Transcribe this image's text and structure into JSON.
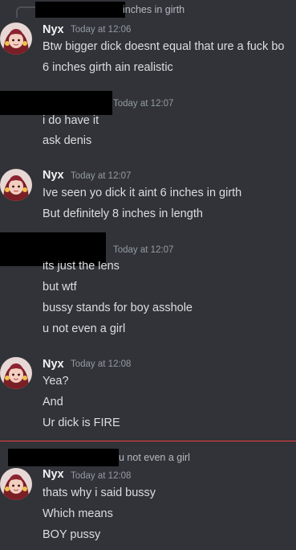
{
  "colors": {
    "background": "#313338",
    "text": "#dbdee1",
    "username": "#f2f3f5",
    "timestamp": "#949ba4",
    "new_messages_divider": "#f23f43"
  },
  "messages": [
    {
      "reply_preview": "inches in girth",
      "author": "Nyx",
      "timestamp": "Today at 12:06",
      "lines": [
        "Btw bigger dick doesnt equal that ure a fuck bo",
        "6 inches girth ain realistic"
      ]
    },
    {
      "author": "",
      "timestamp": "Today at 12:07",
      "lines": [
        "i do have it",
        "ask denis"
      ]
    },
    {
      "author": "Nyx",
      "timestamp": "Today at 12:07",
      "lines": [
        "Ive seen yo dick it aint 6 inches in girth",
        "But definitely 8 inches in length"
      ]
    },
    {
      "author": "",
      "timestamp": "Today at 12:07",
      "lines": [
        "its just the lens",
        "but wtf",
        "bussy stands for boy asshole",
        "u not even a girl"
      ]
    },
    {
      "author": "Nyx",
      "timestamp": "Today at 12:08",
      "lines": [
        "Yea?",
        "And",
        "Ur dick is FIRE"
      ]
    },
    {
      "reply_preview": "u not even a girl",
      "author": "Nyx",
      "timestamp": "Today at 12:08",
      "lines": [
        "thats why i said bussy",
        "Which means",
        "BOY pussy"
      ]
    }
  ]
}
